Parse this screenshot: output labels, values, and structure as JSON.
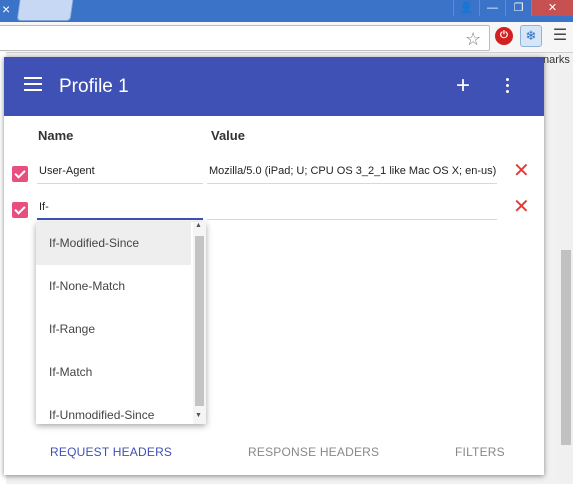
{
  "browser": {
    "tab_close": "×",
    "window_buttons": [
      "👤",
      "—",
      "❐",
      "✕"
    ],
    "extension_red_label": "⏻",
    "extension_modheader_label": "❄",
    "bookmarks_partial": "narks"
  },
  "popup": {
    "title": "Profile 1",
    "columns": {
      "name": "Name",
      "value": "Value"
    },
    "rows": [
      {
        "checked": true,
        "name": "User-Agent",
        "value": "Mozilla/5.0 (iPad; U; CPU OS 3_2_1 like Mac OS X; en-us)"
      },
      {
        "checked": true,
        "name": "If-",
        "value": ""
      }
    ],
    "autocomplete": [
      "If-Modified-Since",
      "If-None-Match",
      "If-Range",
      "If-Match",
      "If-Unmodified-Since"
    ],
    "tabs": [
      "REQUEST HEADERS",
      "RESPONSE HEADERS",
      "FILTERS"
    ],
    "active_tab": "REQUEST HEADERS"
  },
  "colors": {
    "primary": "#3f51b5",
    "checkbox": "#e84f7e",
    "delete": "#e53935"
  }
}
